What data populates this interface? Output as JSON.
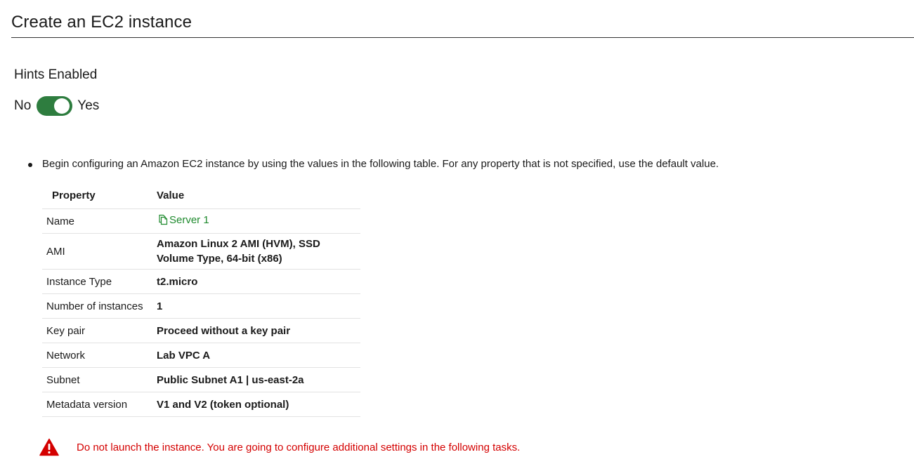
{
  "header": {
    "title": "Create an EC2 instance"
  },
  "hints": {
    "label": "Hints Enabled",
    "no_label": "No",
    "yes_label": "Yes",
    "enabled": true,
    "toggle_color": "#2e7d3f"
  },
  "instructions": {
    "bullet_text": "Begin configuring an Amazon EC2 instance by using the values in the following table. For any property that is not specified, use the default value."
  },
  "table": {
    "headers": [
      "Property",
      "Value"
    ],
    "rows": [
      {
        "property": "Name",
        "value": "Server 1",
        "copyable": true,
        "icon": "copy-icon"
      },
      {
        "property": "AMI",
        "value": "Amazon Linux 2 AMI (HVM), SSD Volume Type, 64-bit (x86)"
      },
      {
        "property": "Instance Type",
        "value": "t2.micro"
      },
      {
        "property": "Number of instances",
        "value": "1"
      },
      {
        "property": "Key pair",
        "value": "Proceed without a key pair"
      },
      {
        "property": "Network",
        "value": "Lab VPC A"
      },
      {
        "property": "Subnet",
        "value": "Public Subnet A1 | us-east-2a"
      },
      {
        "property": "Metadata version",
        "value": "V1 and V2 (token optional)"
      }
    ]
  },
  "warning": {
    "icon": "warning-triangle-icon",
    "text": "Do not launch the instance. You are going to configure additional settings in the following tasks.",
    "color": "#d40000"
  },
  "colors": {
    "link_green": "#1f8a2e"
  }
}
